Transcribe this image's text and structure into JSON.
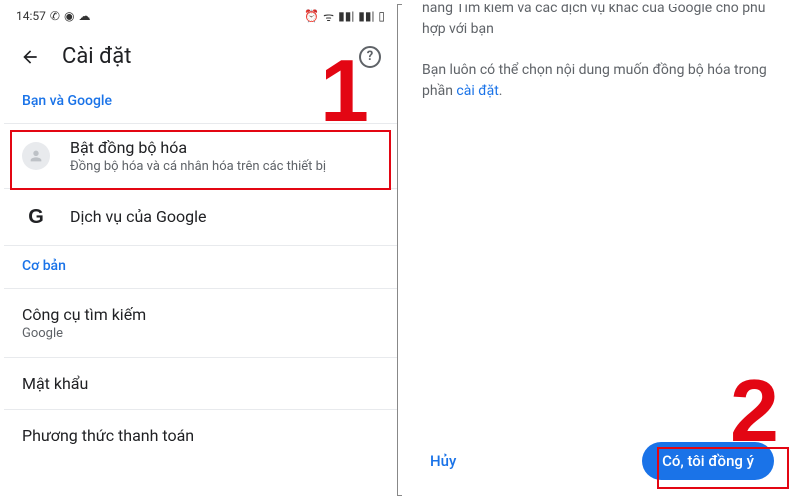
{
  "statusbar": {
    "time": "14:57"
  },
  "header": {
    "title": "Cài đặt"
  },
  "section1": {
    "label": "Bạn và Google",
    "sync": {
      "title": "Bật đồng bộ hóa",
      "subtitle": "Đồng bộ hóa và cá nhân hóa trên các thiết bị"
    },
    "services": {
      "title": "Dịch vụ của Google"
    }
  },
  "section2": {
    "label": "Cơ bản",
    "search": {
      "title": "Công cụ tìm kiếm",
      "value": "Google"
    },
    "passwords": {
      "title": "Mật khẩu"
    },
    "payment": {
      "title": "Phương thức thanh toán"
    }
  },
  "right": {
    "cut_text": "năng Tìm kiếm và các dịch vụ khác của Google cho phù hợp với bạn",
    "body": "Bạn luôn có thể chọn nội dung muốn đồng bộ hóa trong phần ",
    "link": "cài đặt",
    "cancel": "Hủy",
    "agree": "Có, tôi đồng ý"
  },
  "annotations": {
    "step1": "1",
    "step2": "2"
  }
}
